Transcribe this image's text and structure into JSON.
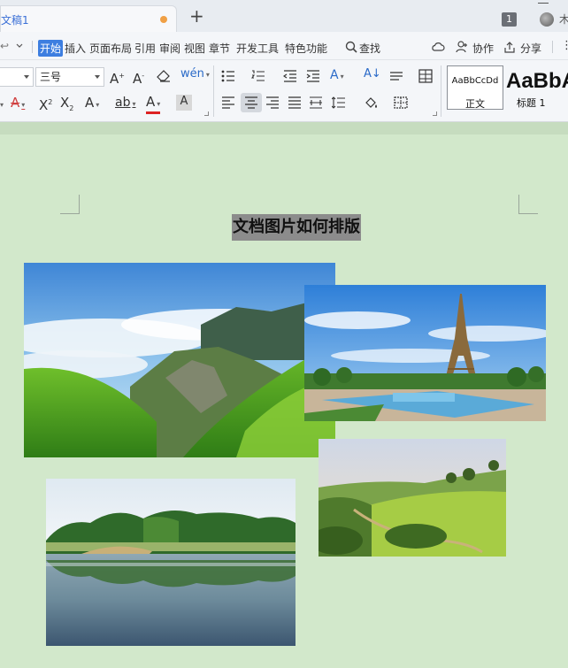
{
  "tab": {
    "title": "文稿1",
    "new_tab_symbol": "+"
  },
  "window": {
    "count_badge": "1",
    "user_label": "木"
  },
  "menu": {
    "items": [
      "开始",
      "插入",
      "页面布局",
      "引用",
      "审阅",
      "视图",
      "章节",
      "开发工具",
      "特色功能"
    ],
    "search_label": "查找",
    "collab_label": "协作",
    "share_label": "分享"
  },
  "ribbon": {
    "font_size_value": "三号",
    "styles": {
      "normal_sample": "AaBbCcDd",
      "normal_label": "正文",
      "heading_sample": "AaBbA",
      "heading_label": "标题 1"
    }
  },
  "document": {
    "title": "文档图片如何排版",
    "images": [
      "mountain-valley-photo",
      "eiffel-tower-photo",
      "green-hills-photo",
      "lake-reflection-photo"
    ]
  }
}
